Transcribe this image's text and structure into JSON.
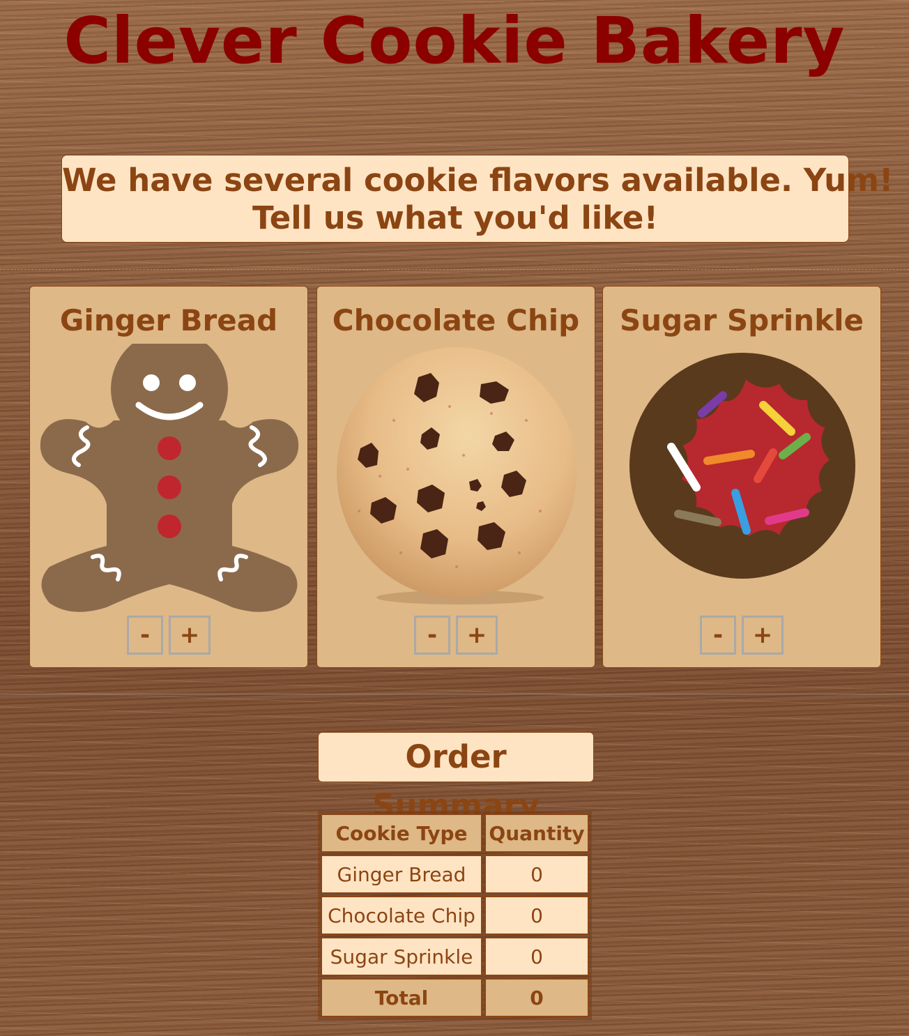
{
  "header": {
    "title": "Clever Cookie Bakery"
  },
  "intro": {
    "line1": "We have several cookie flavors available. Yum!",
    "line2": "Tell us what you'd like!"
  },
  "cookies": [
    {
      "name": "Ginger Bread",
      "minus": "-",
      "plus": "+",
      "icon": "gingerbread-man-image"
    },
    {
      "name": "Chocolate Chip",
      "minus": "-",
      "plus": "+",
      "icon": "chocolate-chip-cookie-image"
    },
    {
      "name": "Sugar Sprinkle",
      "minus": "-",
      "plus": "+",
      "icon": "sugar-sprinkle-cookie-image"
    }
  ],
  "summary": {
    "title": "Order Summary",
    "headers": [
      "Cookie Type",
      "Quantity"
    ],
    "rows": [
      {
        "type": "Ginger Bread",
        "qty": "0"
      },
      {
        "type": "Chocolate Chip",
        "qty": "0"
      },
      {
        "type": "Sugar Sprinkle",
        "qty": "0"
      }
    ],
    "total_label": "Total",
    "total_qty": "0"
  },
  "colors": {
    "title": "#8b0000",
    "text": "#8b4513",
    "card_bg": "#deb887",
    "panel_bg": "#ffe4c4"
  }
}
